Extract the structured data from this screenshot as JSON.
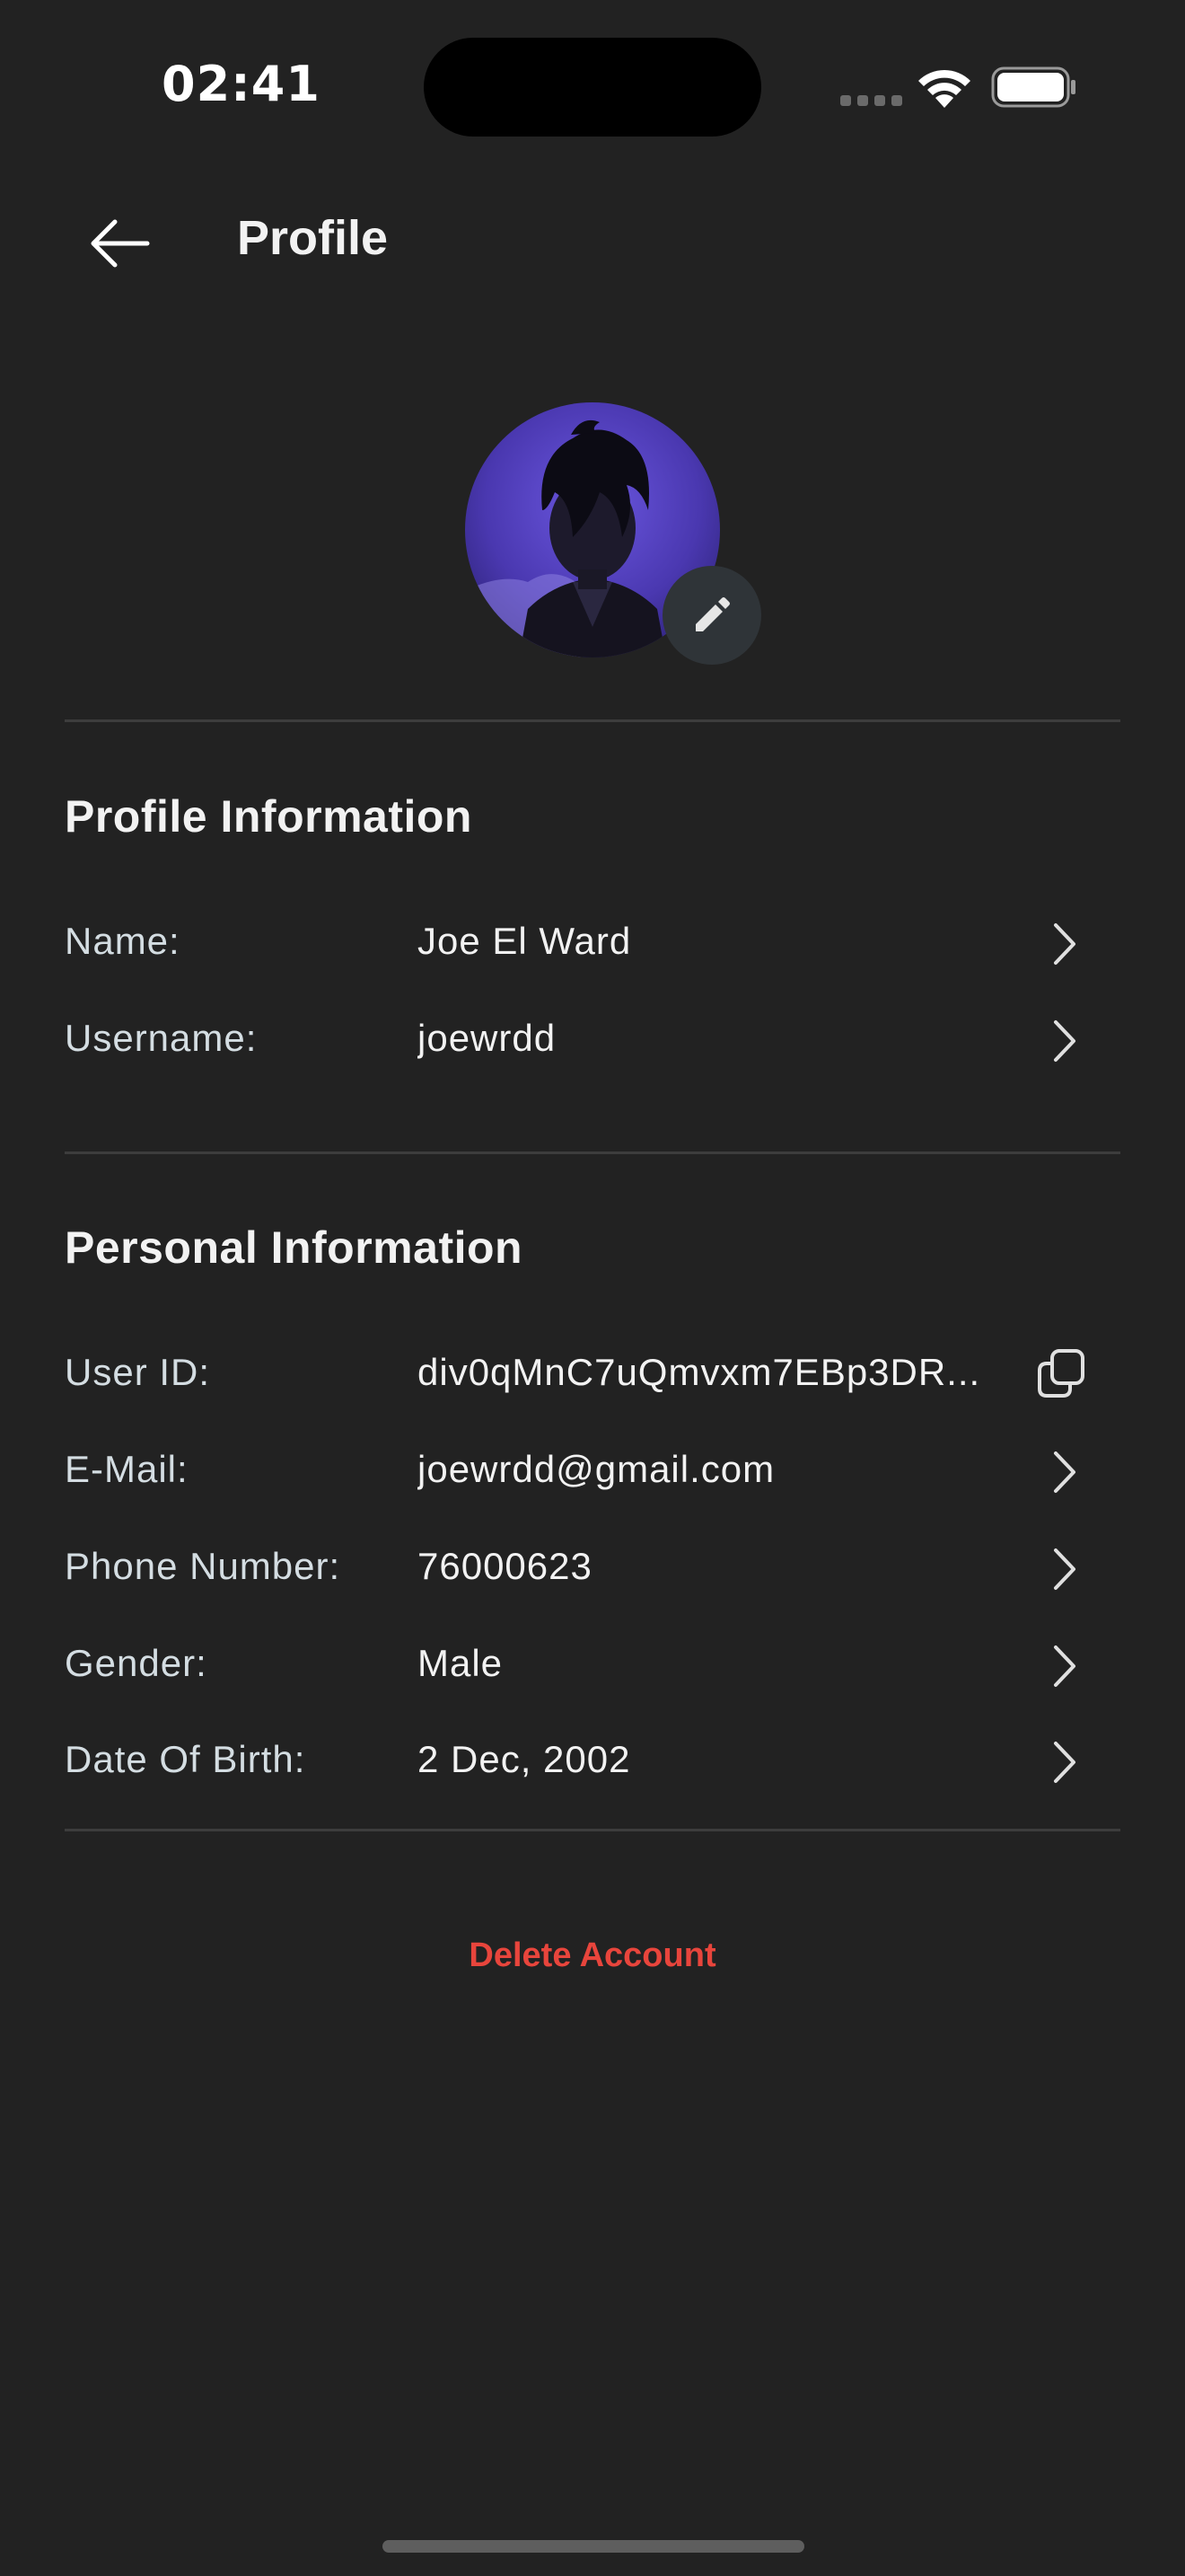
{
  "status_bar": {
    "time": "02:41"
  },
  "header": {
    "title": "Profile",
    "back_icon": "arrow-left-icon"
  },
  "avatar": {
    "edit_icon": "pencil-icon"
  },
  "profile_section": {
    "title": "Profile Information",
    "rows": [
      {
        "label": "Name:",
        "value": "Joe El Ward"
      },
      {
        "label": "Username:",
        "value": "joewrdd"
      }
    ]
  },
  "personal_section": {
    "title": "Personal Information",
    "rows": [
      {
        "label": "User ID:",
        "value": "div0qMnC7uQmvxm7EBp3DR..."
      },
      {
        "label": "E-Mail:",
        "value": "joewrdd@gmail.com"
      },
      {
        "label": "Phone Number:",
        "value": "76000623"
      },
      {
        "label": "Gender:",
        "value": "Male"
      },
      {
        "label": "Date Of Birth:",
        "value": "2 Dec, 2002"
      }
    ]
  },
  "delete_account_label": "Delete Account",
  "colors": {
    "background": "#222222",
    "danger": "#e8453c",
    "avatar_accent": "#5a46c8"
  }
}
